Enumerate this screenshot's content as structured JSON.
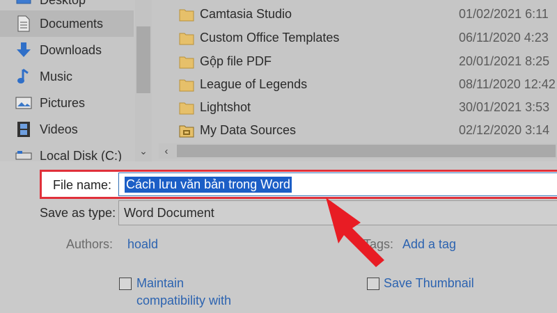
{
  "navigation": {
    "items": [
      {
        "label": "Desktop",
        "icon": "desktop-icon"
      },
      {
        "label": "Documents",
        "icon": "documents-icon",
        "selected": true
      },
      {
        "label": "Downloads",
        "icon": "downloads-icon"
      },
      {
        "label": "Music",
        "icon": "music-icon"
      },
      {
        "label": "Pictures",
        "icon": "pictures-icon"
      },
      {
        "label": "Videos",
        "icon": "videos-icon"
      },
      {
        "label": "Local Disk (C:)",
        "icon": "local-disk-icon"
      }
    ]
  },
  "files": [
    {
      "name": "Camtasia Studio",
      "date": "01/02/2021 6:11",
      "icon": "folder-icon"
    },
    {
      "name": "Custom Office Templates",
      "date": "06/11/2020 4:23",
      "icon": "folder-icon"
    },
    {
      "name": "Gộp file PDF",
      "date": "20/01/2021 8:25",
      "icon": "folder-icon"
    },
    {
      "name": "League of Legends",
      "date": "08/11/2020 12:42",
      "icon": "folder-icon"
    },
    {
      "name": "Lightshot",
      "date": "30/01/2021 3:53",
      "icon": "folder-icon"
    },
    {
      "name": "My Data Sources",
      "date": "02/12/2020 3:14",
      "icon": "data-sources-folder-icon"
    }
  ],
  "form": {
    "file_name_label": "File name:",
    "file_name_value": "Cách lưu văn bản trong Word",
    "save_as_type_label": "Save as type:",
    "save_as_type_value": "Word Document",
    "authors_label": "Authors:",
    "authors_value": "hoald",
    "tags_label": "Tags:",
    "tags_value": "Add a tag",
    "maintain_line1": "Maintain",
    "maintain_line2": "compatibility with",
    "save_thumbnail_label": "Save Thumbnail"
  },
  "colors": {
    "highlight_border": "#e0303a",
    "selection": "#1c5ec6",
    "link": "#2c63b0",
    "arrow": "#e81c24"
  }
}
